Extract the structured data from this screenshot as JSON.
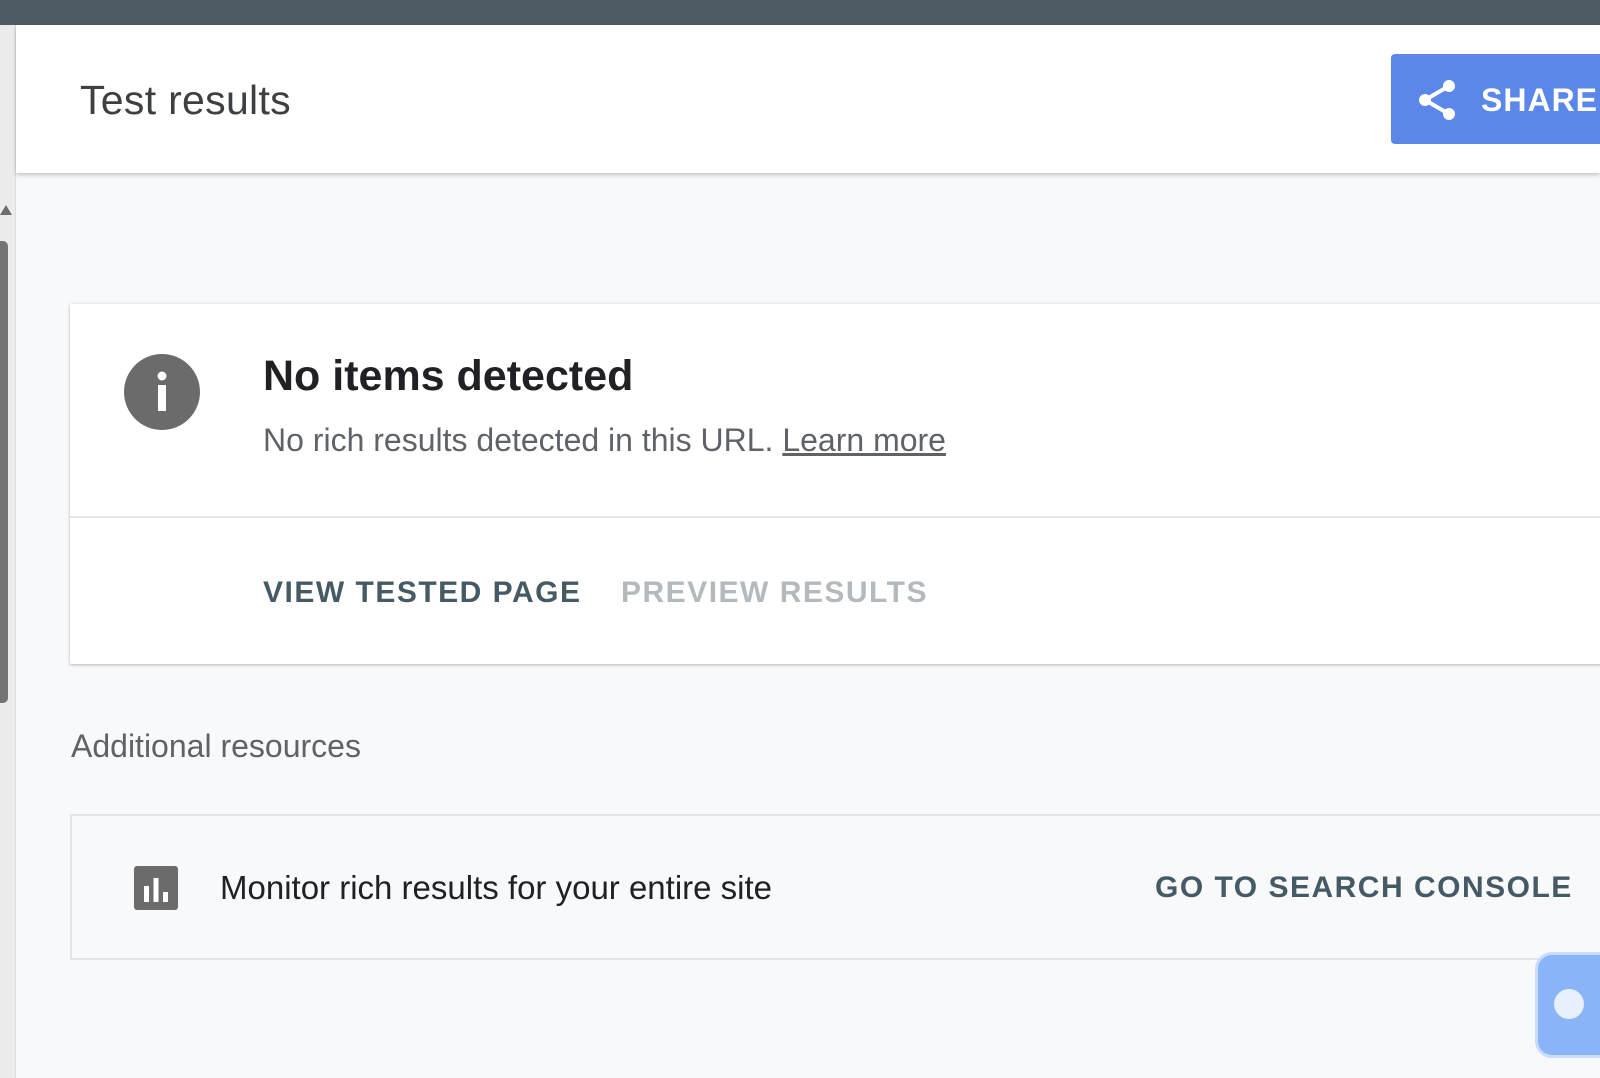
{
  "header": {
    "title": "Test results",
    "share_label": "SHARE"
  },
  "result": {
    "title": "No items detected",
    "description": "No rich results detected in this URL.",
    "learn_more": "Learn more",
    "view_tested_page": "VIEW TESTED PAGE",
    "preview_results": "PREVIEW RESULTS"
  },
  "resources": {
    "heading": "Additional resources",
    "items": [
      {
        "icon": "bar-chart-icon",
        "text": "Monitor rich results for your entire site",
        "action": "GO TO SEARCH CONSOLE"
      }
    ]
  },
  "colors": {
    "topbar": "#4f5b64",
    "share_button": "#5b87e8",
    "info_icon": "#6b6b6b",
    "action_text": "#455a64",
    "disabled_text": "#b3b9bd",
    "floating_button": "#8ab4f8"
  },
  "icons": {
    "share": "share-icon",
    "info": "info-icon",
    "chart": "bar-chart-icon"
  }
}
